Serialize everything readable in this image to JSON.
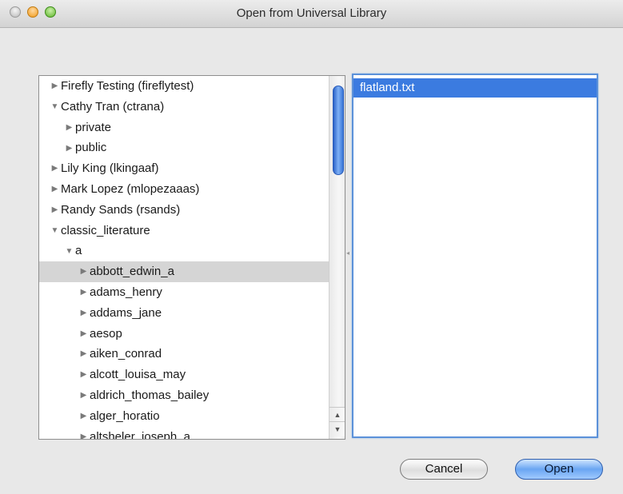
{
  "window": {
    "title": "Open from Universal Library"
  },
  "tree": {
    "items": [
      {
        "label": "Firefly Testing (fireflytest)",
        "level": 0,
        "disclosure": "▶",
        "selected": false
      },
      {
        "label": "Cathy Tran (ctrana)",
        "level": 0,
        "disclosure": "▼",
        "selected": false
      },
      {
        "label": "private",
        "level": 1,
        "disclosure": "▶",
        "selected": false
      },
      {
        "label": "public",
        "level": 1,
        "disclosure": "▶",
        "selected": false
      },
      {
        "label": "Lily King (lkingaaf)",
        "level": 0,
        "disclosure": "▶",
        "selected": false
      },
      {
        "label": "Mark Lopez (mlopezaaas)",
        "level": 0,
        "disclosure": "▶",
        "selected": false
      },
      {
        "label": "Randy Sands (rsands)",
        "level": 0,
        "disclosure": "▶",
        "selected": false
      },
      {
        "label": "classic_literature",
        "level": 0,
        "disclosure": "▼",
        "selected": false
      },
      {
        "label": "a",
        "level": 1,
        "disclosure": "▼",
        "selected": false
      },
      {
        "label": "abbott_edwin_a",
        "level": 2,
        "disclosure": "▶",
        "selected": true
      },
      {
        "label": "adams_henry",
        "level": 2,
        "disclosure": "▶",
        "selected": false
      },
      {
        "label": "addams_jane",
        "level": 2,
        "disclosure": "▶",
        "selected": false
      },
      {
        "label": "aesop",
        "level": 2,
        "disclosure": "▶",
        "selected": false
      },
      {
        "label": "aiken_conrad",
        "level": 2,
        "disclosure": "▶",
        "selected": false
      },
      {
        "label": "alcott_louisa_may",
        "level": 2,
        "disclosure": "▶",
        "selected": false
      },
      {
        "label": "aldrich_thomas_bailey",
        "level": 2,
        "disclosure": "▶",
        "selected": false
      },
      {
        "label": "alger_horatio",
        "level": 2,
        "disclosure": "▶",
        "selected": false
      },
      {
        "label": "altsheler_joseph_a",
        "level": 2,
        "disclosure": "▶",
        "selected": false
      }
    ]
  },
  "files": {
    "items": [
      {
        "label": "flatland.txt",
        "selected": true
      }
    ]
  },
  "buttons": {
    "cancel_label": "Cancel",
    "open_label": "Open"
  },
  "colors": {
    "selection_blue": "#3b7be0",
    "tree_selection_gray": "#d5d5d5"
  }
}
